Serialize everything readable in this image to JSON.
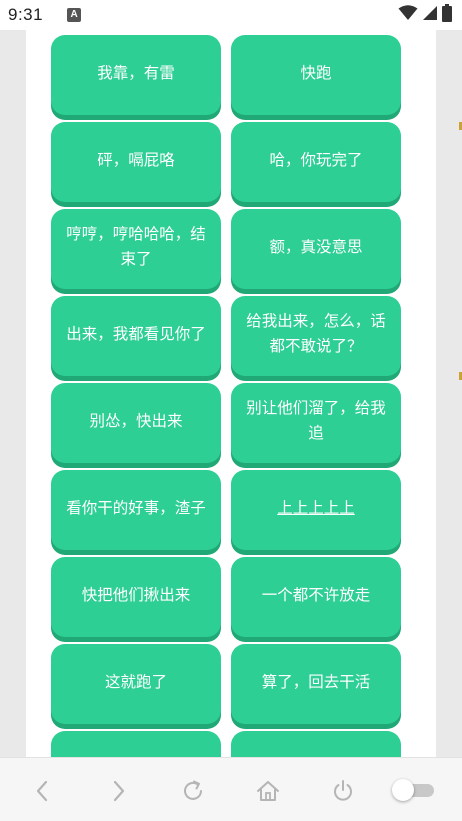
{
  "status_bar": {
    "time": "9:31",
    "notification_glyph": "A",
    "icons": [
      "wifi-icon",
      "signal-icon",
      "battery-icon"
    ]
  },
  "sound_buttons": [
    {
      "label": "我靠，有雷"
    },
    {
      "label": "快跑"
    },
    {
      "label": "砰，嗝屁咯"
    },
    {
      "label": "哈，你玩完了"
    },
    {
      "label": "哼哼，哼哈哈哈，结束了"
    },
    {
      "label": "额，真没意思"
    },
    {
      "label": "出来，我都看见你了"
    },
    {
      "label": "给我出来，怎么，话都不敢说了？"
    },
    {
      "label": "别怂，快出来"
    },
    {
      "label": "别让他们溜了，给我追"
    },
    {
      "label": "看你干的好事，渣子"
    },
    {
      "label": "上上上上上"
    },
    {
      "label": "快把他们揪出来"
    },
    {
      "label": "一个都不许放走"
    },
    {
      "label": "这就跑了"
    },
    {
      "label": "算了，回去干活"
    },
    {
      "label": ""
    },
    {
      "label": ""
    }
  ],
  "bottom_nav": {
    "items": [
      "back-icon",
      "forward-icon",
      "refresh-icon",
      "home-icon",
      "power-icon"
    ],
    "toggle_on": false
  },
  "colors": {
    "button": "#2ecf95",
    "button_shadow": "#21a877",
    "nav_icon": "#b5b5b5"
  }
}
